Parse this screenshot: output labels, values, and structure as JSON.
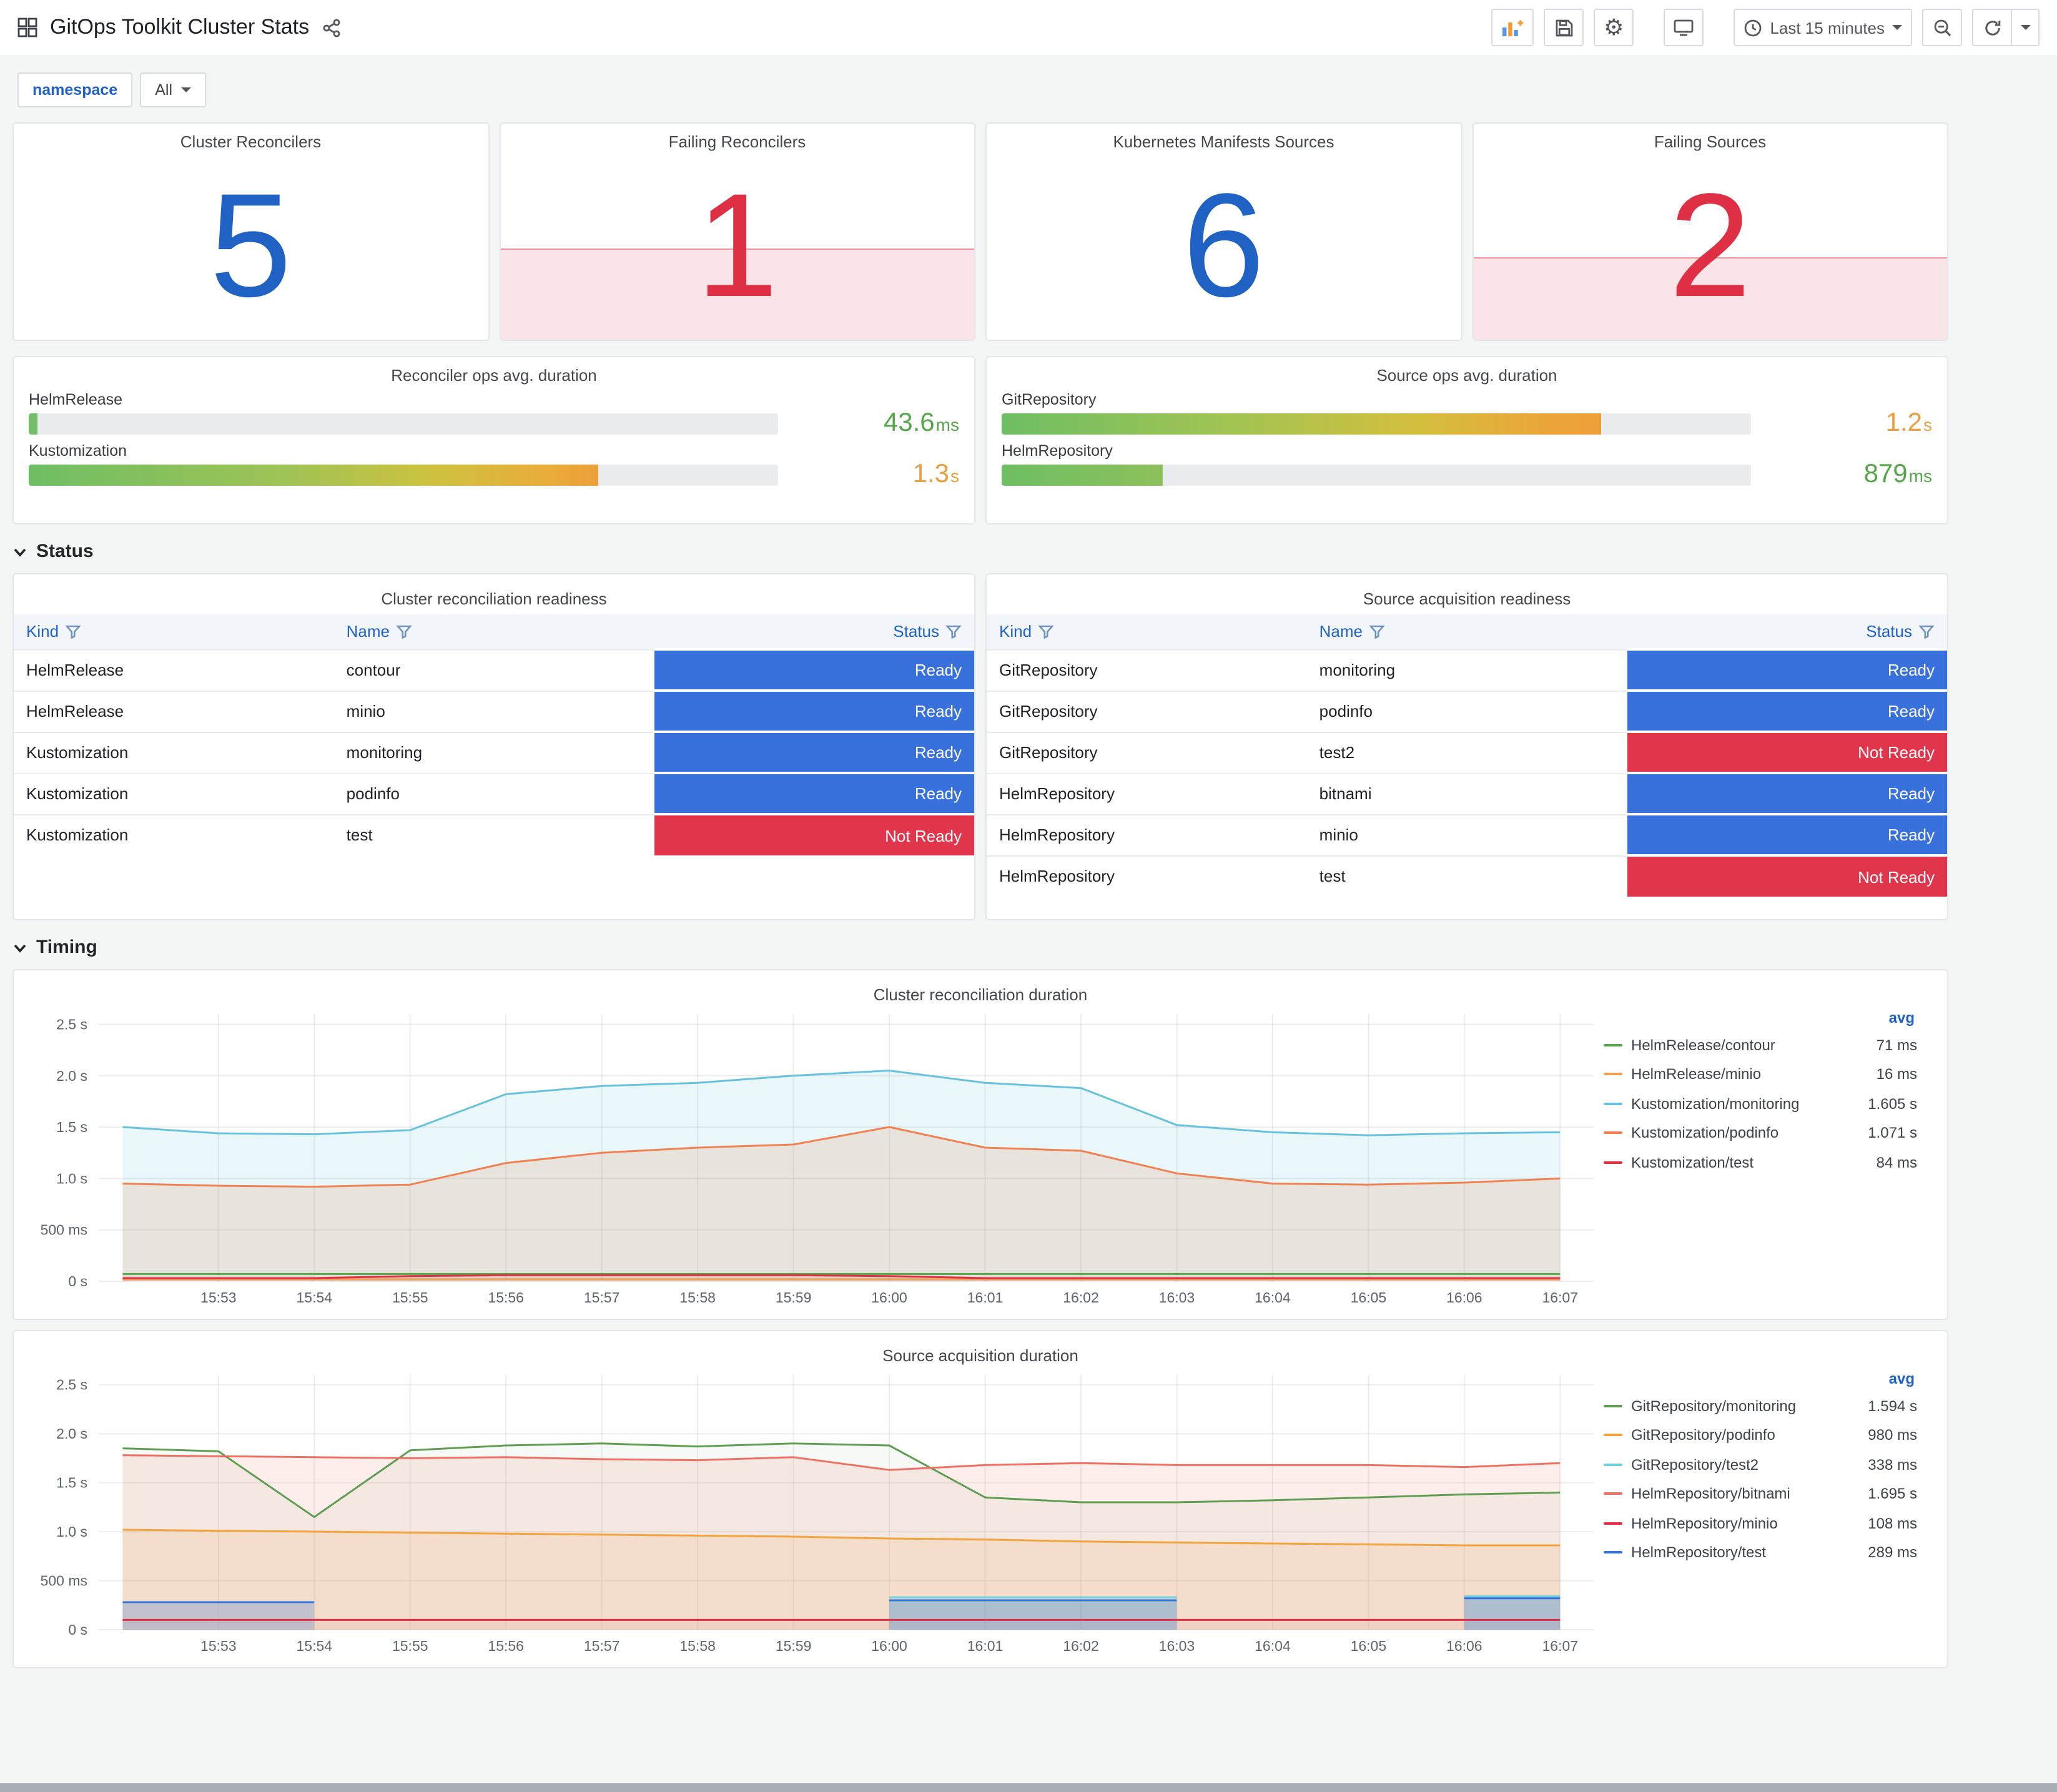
{
  "header": {
    "title": "GitOps Toolkit Cluster Stats",
    "time_picker_label": "Last 15 minutes",
    "icons": {
      "gear": "⚙"
    }
  },
  "filters": {
    "variable_label": "namespace",
    "variable_value": "All"
  },
  "colors": {
    "blue": "#1f62c4",
    "red": "#de2f44",
    "ready": "#3871dc",
    "not_ready": "#e0354b",
    "alert_fill": "rgba(224,47,68,0.13)"
  },
  "stat_panels": [
    {
      "title": "Cluster Reconcilers",
      "value": "5",
      "value_color": "#1f62c4"
    },
    {
      "title": "Failing Reconcilers",
      "value": "1",
      "value_color": "#de2f44",
      "fill_height": "42%",
      "fill_bg": "rgba(224,47,68,0.13)"
    },
    {
      "title": "Kubernetes Manifests Sources",
      "value": "6",
      "value_color": "#1f62c4"
    },
    {
      "title": "Failing Sources",
      "value": "2",
      "value_color": "#de2f44",
      "fill_height": "38%",
      "fill_bg": "rgba(224,47,68,0.13)"
    }
  ],
  "gauge_panels": [
    {
      "title": "Reconciler ops avg. duration",
      "rows": [
        {
          "label": "HelmRelease",
          "num": "43.6",
          "unit": "ms",
          "value_color": "#56a64b",
          "pct": "1.2%",
          "fill_bg": "#73bf69"
        },
        {
          "label": "Kustomization",
          "num": "1.3",
          "unit": "s",
          "value_color": "#eb9e3e",
          "pct": "76%",
          "fill_bg": "linear-gradient(90deg,#6ebe64,#9fc356 45%,#ccc23f 70%,#e8ae39 90%,#eda13b)"
        }
      ]
    },
    {
      "title": "Source ops avg. duration",
      "rows": [
        {
          "label": "GitRepository",
          "num": "1.2",
          "unit": "s",
          "value_color": "#eb9e3e",
          "pct": "80%",
          "fill_bg": "linear-gradient(90deg,#6ebe64,#a5c452 40%,#d4be3c 70%,#eda43a 92%,#ee9f3a)"
        },
        {
          "label": "HelmRepository",
          "num": "879",
          "unit": "ms",
          "value_color": "#56a64b",
          "pct": "21.5%",
          "fill_bg": "linear-gradient(90deg,#6ebe64,#8ec05b)"
        }
      ]
    }
  ],
  "sections": {
    "status": "Status",
    "timing": "Timing"
  },
  "tables": [
    {
      "title": "Cluster reconciliation readiness",
      "columns": [
        "Kind",
        "Name",
        "Status"
      ],
      "rows": [
        {
          "kind": "HelmRelease",
          "name": "contour",
          "status": "Ready"
        },
        {
          "kind": "HelmRelease",
          "name": "minio",
          "status": "Ready"
        },
        {
          "kind": "Kustomization",
          "name": "monitoring",
          "status": "Ready"
        },
        {
          "kind": "Kustomization",
          "name": "podinfo",
          "status": "Ready"
        },
        {
          "kind": "Kustomization",
          "name": "test",
          "status": "Not Ready"
        }
      ]
    },
    {
      "title": "Source acquisition readiness",
      "columns": [
        "Kind",
        "Name",
        "Status"
      ],
      "rows": [
        {
          "kind": "GitRepository",
          "name": "monitoring",
          "status": "Ready"
        },
        {
          "kind": "GitRepository",
          "name": "podinfo",
          "status": "Ready"
        },
        {
          "kind": "GitRepository",
          "name": "test2",
          "status": "Not Ready"
        },
        {
          "kind": "HelmRepository",
          "name": "bitnami",
          "status": "Ready"
        },
        {
          "kind": "HelmRepository",
          "name": "minio",
          "status": "Ready"
        },
        {
          "kind": "HelmRepository",
          "name": "test",
          "status": "Not Ready"
        }
      ]
    }
  ],
  "chart_data": [
    {
      "type": "line",
      "title": "Cluster reconciliation duration",
      "legend_header": "avg",
      "x": [
        0,
        1,
        2,
        3,
        4,
        5,
        6,
        7,
        8,
        9,
        10,
        11,
        12,
        13,
        14,
        15
      ],
      "xlim": [
        -0.25,
        15.35
      ],
      "ylim": [
        0,
        2.6
      ],
      "xticks": [
        {
          "v": 1,
          "label": "15:53"
        },
        {
          "v": 2,
          "label": "15:54"
        },
        {
          "v": 3,
          "label": "15:55"
        },
        {
          "v": 4,
          "label": "15:56"
        },
        {
          "v": 5,
          "label": "15:57"
        },
        {
          "v": 6,
          "label": "15:58"
        },
        {
          "v": 7,
          "label": "15:59"
        },
        {
          "v": 8,
          "label": "16:00"
        },
        {
          "v": 9,
          "label": "16:01"
        },
        {
          "v": 10,
          "label": "16:02"
        },
        {
          "v": 11,
          "label": "16:03"
        },
        {
          "v": 12,
          "label": "16:04"
        },
        {
          "v": 13,
          "label": "16:05"
        },
        {
          "v": 14,
          "label": "16:06"
        },
        {
          "v": 15,
          "label": "16:07"
        }
      ],
      "yticks": [
        {
          "v": 0,
          "label": "0 s"
        },
        {
          "v": 0.5,
          "label": "500 ms"
        },
        {
          "v": 1,
          "label": "1.0 s"
        },
        {
          "v": 1.5,
          "label": "1.5 s"
        },
        {
          "v": 2,
          "label": "2.0 s"
        },
        {
          "v": 2.5,
          "label": "2.5 s"
        }
      ],
      "series": [
        {
          "name": "HelmRelease/contour",
          "avg": "71 ms",
          "color": "#56a64b",
          "fill": 0.05,
          "values": [
            0.07,
            0.07,
            0.07,
            0.07,
            0.07,
            0.07,
            0.07,
            0.07,
            0.07,
            0.07,
            0.07,
            0.07,
            0.07,
            0.07,
            0.07,
            0.07
          ]
        },
        {
          "name": "HelmRelease/minio",
          "avg": "16 ms",
          "color": "#f2a154",
          "fill": 0.05,
          "values": [
            0.02,
            0.02,
            0.02,
            0.02,
            0.02,
            0.02,
            0.02,
            0.02,
            0.02,
            0.02,
            0.02,
            0.02,
            0.02,
            0.02,
            0.02,
            0.02
          ]
        },
        {
          "name": "Kustomization/monitoring",
          "avg": "1.605 s",
          "color": "#66c2dd",
          "fill": 0.14,
          "values": [
            1.5,
            1.44,
            1.43,
            1.47,
            1.82,
            1.9,
            1.93,
            2.0,
            2.05,
            1.93,
            1.88,
            1.52,
            1.45,
            1.42,
            1.44,
            1.45
          ]
        },
        {
          "name": "Kustomization/podinfo",
          "avg": "1.071 s",
          "color": "#ef8250",
          "fill": 0.16,
          "values": [
            0.95,
            0.93,
            0.92,
            0.94,
            1.15,
            1.25,
            1.3,
            1.33,
            1.5,
            1.3,
            1.27,
            1.05,
            0.95,
            0.94,
            0.96,
            1.0
          ]
        },
        {
          "name": "Kustomization/test",
          "avg": "84 ms",
          "color": "#e02f44",
          "fill": 0.1,
          "values": [
            0.03,
            0.03,
            0.03,
            0.05,
            0.06,
            0.06,
            0.06,
            0.06,
            0.05,
            0.03,
            0.03,
            0.03,
            0.03,
            0.03,
            0.03,
            0.03
          ]
        }
      ]
    },
    {
      "type": "line",
      "title": "Source acquisition duration",
      "legend_header": "avg",
      "x": [
        0,
        1,
        2,
        3,
        4,
        5,
        6,
        7,
        8,
        9,
        10,
        11,
        12,
        13,
        14,
        15
      ],
      "xlim": [
        -0.25,
        15.35
      ],
      "ylim": [
        0,
        2.6
      ],
      "xticks": [
        {
          "v": 1,
          "label": "15:53"
        },
        {
          "v": 2,
          "label": "15:54"
        },
        {
          "v": 3,
          "label": "15:55"
        },
        {
          "v": 4,
          "label": "15:56"
        },
        {
          "v": 5,
          "label": "15:57"
        },
        {
          "v": 6,
          "label": "15:58"
        },
        {
          "v": 7,
          "label": "15:59"
        },
        {
          "v": 8,
          "label": "16:00"
        },
        {
          "v": 9,
          "label": "16:01"
        },
        {
          "v": 10,
          "label": "16:02"
        },
        {
          "v": 11,
          "label": "16:03"
        },
        {
          "v": 12,
          "label": "16:04"
        },
        {
          "v": 13,
          "label": "16:05"
        },
        {
          "v": 14,
          "label": "16:06"
        },
        {
          "v": 15,
          "label": "16:07"
        }
      ],
      "yticks": [
        {
          "v": 0,
          "label": "0 s"
        },
        {
          "v": 0.5,
          "label": "500 ms"
        },
        {
          "v": 1,
          "label": "1.0 s"
        },
        {
          "v": 1.5,
          "label": "1.5 s"
        },
        {
          "v": 2,
          "label": "2.0 s"
        },
        {
          "v": 2.5,
          "label": "2.5 s"
        }
      ],
      "series": [
        {
          "name": "GitRepository/monitoring",
          "avg": "1.594 s",
          "color": "#5f9e52",
          "fill": 0.06,
          "values": [
            1.85,
            1.82,
            1.15,
            1.83,
            1.88,
            1.9,
            1.87,
            1.9,
            1.88,
            1.35,
            1.3,
            1.3,
            1.32,
            1.35,
            1.38,
            1.4
          ]
        },
        {
          "name": "GitRepository/podinfo",
          "avg": "980 ms",
          "color": "#f2a33c",
          "fill": 0.14,
          "values": [
            1.02,
            1.01,
            1.0,
            0.99,
            0.98,
            0.97,
            0.96,
            0.95,
            0.93,
            0.92,
            0.9,
            0.89,
            0.88,
            0.87,
            0.86,
            0.86
          ]
        },
        {
          "name": "GitRepository/test2",
          "avg": "338 ms",
          "color": "#6ed0e0",
          "fill": 0.25,
          "values": [
            null,
            null,
            null,
            null,
            null,
            null,
            null,
            null,
            0.33,
            0.33,
            0.33,
            0.33,
            null,
            null,
            0.34,
            0.34
          ]
        },
        {
          "name": "HelmRepository/bitnami",
          "avg": "1.695 s",
          "color": "#ec7063",
          "fill": 0.12,
          "values": [
            1.78,
            1.77,
            1.76,
            1.75,
            1.76,
            1.74,
            1.73,
            1.76,
            1.63,
            1.68,
            1.7,
            1.68,
            1.68,
            1.68,
            1.66,
            1.7
          ]
        },
        {
          "name": "HelmRepository/minio",
          "avg": "108 ms",
          "color": "#e02f44",
          "fill": 0.05,
          "values": [
            0.1,
            0.1,
            0.1,
            0.1,
            0.1,
            0.1,
            0.1,
            0.1,
            0.1,
            0.1,
            0.1,
            0.1,
            0.1,
            0.1,
            0.1,
            0.1
          ]
        },
        {
          "name": "HelmRepository/test",
          "avg": "289 ms",
          "color": "#3274d9",
          "fill": 0.25,
          "values": [
            0.28,
            0.28,
            0.28,
            null,
            null,
            null,
            null,
            null,
            0.3,
            0.3,
            0.3,
            0.3,
            null,
            null,
            0.32,
            0.32
          ]
        }
      ]
    }
  ]
}
